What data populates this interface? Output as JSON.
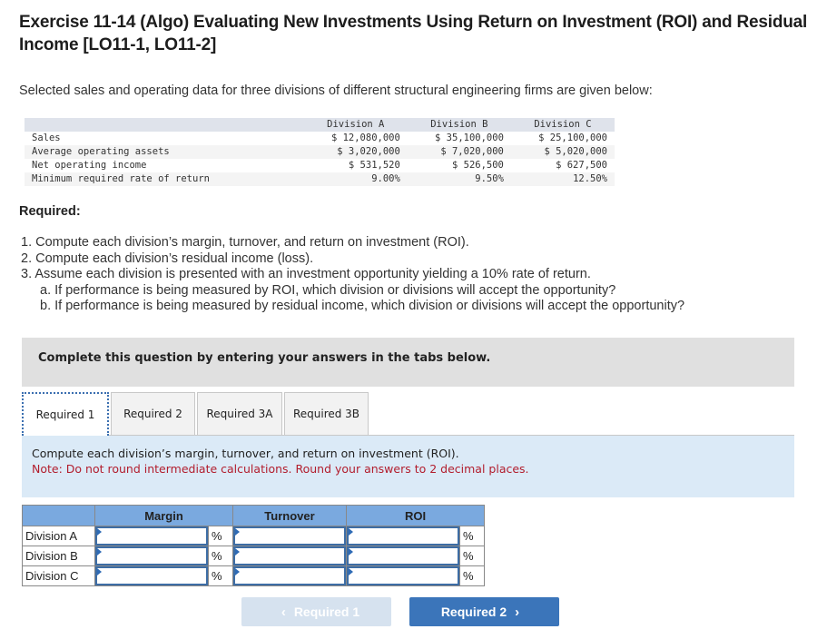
{
  "title": "Exercise 11-14 (Algo) Evaluating New Investments Using Return on Investment (ROI) and Residual Income [LO11-1, LO11-2]",
  "intro": "Selected sales and operating data for three divisions of different structural engineering firms are given below:",
  "data_table": {
    "headers": [
      "",
      "Division A",
      "Division B",
      "Division C"
    ],
    "rows": [
      {
        "label": "Sales",
        "values": [
          "$ 12,080,000",
          "$ 35,100,000",
          "$ 25,100,000"
        ]
      },
      {
        "label": "Average operating assets",
        "values": [
          "$ 3,020,000",
          "$ 7,020,000",
          "$ 5,020,000"
        ]
      },
      {
        "label": "Net operating income",
        "values": [
          "$ 531,520",
          "$ 526,500",
          "$ 627,500"
        ]
      },
      {
        "label": "Minimum required rate of return",
        "values": [
          "9.00%",
          "9.50%",
          "12.50%"
        ]
      }
    ]
  },
  "required": {
    "label": "Required:",
    "items": [
      "1. Compute each division’s margin, turnover, and return on investment (ROI).",
      "2. Compute each division’s residual income (loss).",
      "3. Assume each division is presented with an investment opportunity yielding a 10% rate of return.",
      "a. If performance is being measured by ROI, which division or divisions will accept the opportunity?",
      "b. If performance is being measured by residual income, which division or divisions will accept the opportunity?"
    ]
  },
  "instruction_bar": "Complete this question by entering your answers in the tabs below.",
  "tabs": [
    {
      "label": "Required 1",
      "active": true
    },
    {
      "label": "Required 2",
      "active": false
    },
    {
      "label": "Required 3A",
      "active": false
    },
    {
      "label": "Required 3B",
      "active": false
    }
  ],
  "panel": {
    "instruction": "Compute each division’s margin, turnover, and return on investment (ROI).",
    "note": "Note: Do not round intermediate calculations. Round your answers to 2 decimal places."
  },
  "answer_table": {
    "headers": [
      "",
      "Margin",
      "Turnover",
      "ROI"
    ],
    "unit": "%",
    "rows": [
      {
        "label": "Division A",
        "margin": "",
        "turnover": "",
        "roi": ""
      },
      {
        "label": "Division B",
        "margin": "",
        "turnover": "",
        "roi": ""
      },
      {
        "label": "Division C",
        "margin": "",
        "turnover": "",
        "roi": ""
      }
    ]
  },
  "nav": {
    "prev_label": "Required 1",
    "next_label": "Required 2",
    "prev_icon": "chevron-left-icon",
    "next_icon": "chevron-right-icon"
  },
  "colors": {
    "accent": "#3b75ba",
    "note_red": "#b21d2d",
    "panel_bg": "#dbeaf7",
    "table_header": "#7aa9df"
  }
}
